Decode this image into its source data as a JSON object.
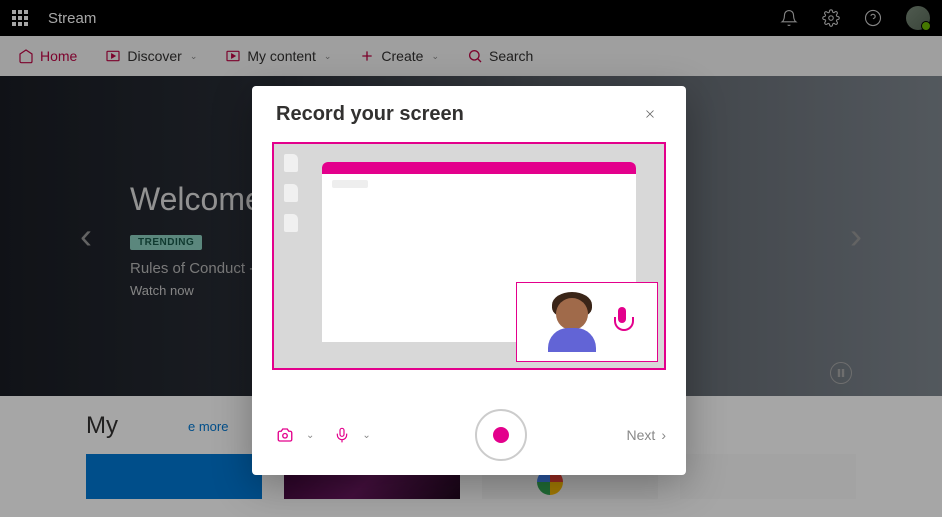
{
  "header": {
    "app_name": "Stream"
  },
  "nav": {
    "home": "Home",
    "discover": "Discover",
    "my_content": "My content",
    "create": "Create",
    "search": "Search"
  },
  "hero": {
    "welcome": "Welcome ba",
    "badge": "TRENDING",
    "subtitle": "Rules of Conduct -",
    "watch": "Watch now"
  },
  "my": {
    "title": "My",
    "see_more": "e more"
  },
  "modal": {
    "title": "Record your screen",
    "next": "Next"
  }
}
